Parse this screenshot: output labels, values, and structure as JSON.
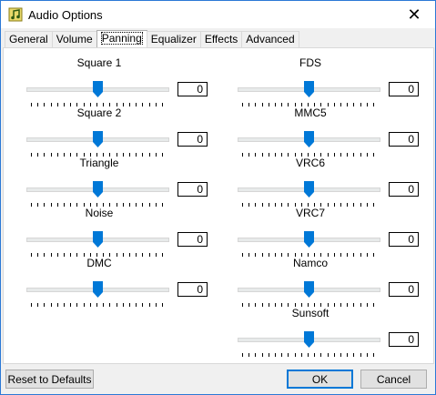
{
  "window": {
    "title": "Audio Options",
    "close_symbol": "✕",
    "icon": "music-note-icon"
  },
  "tabs": [
    {
      "label": "General"
    },
    {
      "label": "Volume"
    },
    {
      "label": "Panning",
      "active": true
    },
    {
      "label": "Equalizer"
    },
    {
      "label": "Effects"
    },
    {
      "label": "Advanced"
    }
  ],
  "channels": [
    {
      "name": "Square 1",
      "value": "0",
      "level": 0.5
    },
    {
      "name": "Square 2",
      "value": "0",
      "level": 0.5
    },
    {
      "name": "Triangle",
      "value": "0",
      "level": 0.5
    },
    {
      "name": "Noise",
      "value": "0",
      "level": 0.5
    },
    {
      "name": "DMC",
      "value": "0",
      "level": 0.5
    },
    {
      "name": "FDS",
      "value": "0",
      "level": 0.5
    },
    {
      "name": "MMC5",
      "value": "0",
      "level": 0.5
    },
    {
      "name": "VRC6",
      "value": "0",
      "level": 0.5
    },
    {
      "name": "VRC7",
      "value": "0",
      "level": 0.5
    },
    {
      "name": "Namco",
      "value": "0",
      "level": 0.5
    },
    {
      "name": "Sunsoft",
      "value": "0",
      "level": 0.5
    }
  ],
  "buttons": {
    "reset": "Reset to Defaults",
    "ok": "OK",
    "cancel": "Cancel"
  },
  "colors": {
    "accent": "#0078d7",
    "border": "#2b79d6"
  }
}
